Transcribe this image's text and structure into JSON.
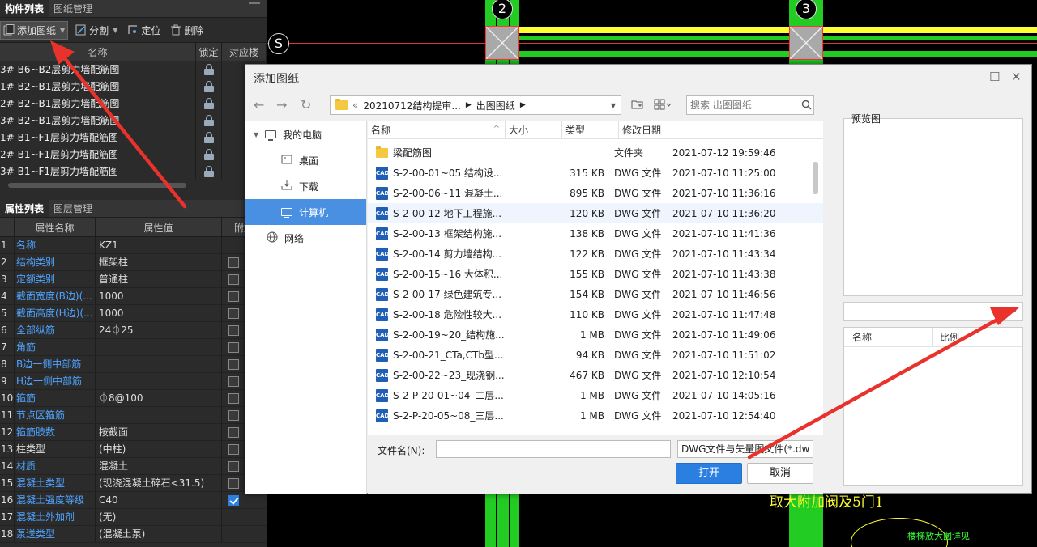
{
  "colors": {
    "accent": "#2b7fe0",
    "arrow": "#e8322b",
    "cad_yellow": "#ffff33",
    "cad_green": "#22cc22",
    "link_blue": "#4ea3ff"
  },
  "cad": {
    "axis_2": "2",
    "axis_3": "3",
    "axis_s": "S",
    "text_bottom": "取大附加阀及5门1",
    "text_right": "楼梯放大图详见"
  },
  "component_panel": {
    "tabs": [
      "构件列表",
      "图纸管理"
    ],
    "toolbar": {
      "add": "添加图纸",
      "split": "分割",
      "locate": "定位",
      "delete": "删除"
    },
    "columns": [
      "名称",
      "锁定",
      "对应楼"
    ],
    "rows": [
      "3#-B6~B2层剪力墙配筋图",
      "1#-B2~B1层剪力墙配筋图",
      "2#-B2~B1层剪力墙配筋图",
      "3#-B2~B1层剪力墙配筋图",
      "1#-B1~F1层剪力墙配筋图",
      "2#-B1~F1层剪力墙配筋图",
      "3#-B1~F1层剪力墙配筋图"
    ]
  },
  "property_panel": {
    "tabs": [
      "属性列表",
      "图层管理"
    ],
    "columns": [
      "属性名称",
      "属性值",
      "附加"
    ],
    "rows": [
      {
        "idx": "1",
        "name": "名称",
        "value": "KZ1",
        "checkbox": false,
        "checked": false,
        "blue": true
      },
      {
        "idx": "2",
        "name": "结构类别",
        "value": "框架柱",
        "checkbox": true,
        "checked": false,
        "blue": true
      },
      {
        "idx": "3",
        "name": "定额类别",
        "value": "普通柱",
        "checkbox": true,
        "checked": false,
        "blue": true
      },
      {
        "idx": "4",
        "name": "截面宽度(B边)(...",
        "value": "1000",
        "checkbox": true,
        "checked": false,
        "blue": true
      },
      {
        "idx": "5",
        "name": "截面高度(H边)(...",
        "value": "1000",
        "checkbox": true,
        "checked": false,
        "blue": true
      },
      {
        "idx": "6",
        "name": "全部纵筋",
        "value": "24⏀25",
        "checkbox": true,
        "checked": false,
        "blue": true
      },
      {
        "idx": "7",
        "name": "角筋",
        "value": "",
        "checkbox": true,
        "checked": false,
        "blue": true
      },
      {
        "idx": "8",
        "name": "B边一侧中部筋",
        "value": "",
        "checkbox": true,
        "checked": false,
        "blue": true
      },
      {
        "idx": "9",
        "name": "H边一侧中部筋",
        "value": "",
        "checkbox": true,
        "checked": false,
        "blue": true
      },
      {
        "idx": "10",
        "name": "箍筋",
        "value": "⏀8@100",
        "checkbox": true,
        "checked": false,
        "blue": true
      },
      {
        "idx": "11",
        "name": "节点区箍筋",
        "value": "",
        "checkbox": true,
        "checked": false,
        "blue": true
      },
      {
        "idx": "12",
        "name": "箍筋肢数",
        "value": "按截面",
        "checkbox": true,
        "checked": false,
        "blue": true
      },
      {
        "idx": "13",
        "name": "柱类型",
        "value": "(中柱)",
        "checkbox": true,
        "checked": false,
        "blue": false
      },
      {
        "idx": "14",
        "name": "材质",
        "value": "混凝土",
        "checkbox": true,
        "checked": false,
        "blue": true
      },
      {
        "idx": "15",
        "name": "混凝土类型",
        "value": "(现浇混凝土碎石<31.5)",
        "checkbox": true,
        "checked": false,
        "blue": true
      },
      {
        "idx": "16",
        "name": "混凝土强度等级",
        "value": "C40",
        "checkbox": true,
        "checked": true,
        "blue": true
      },
      {
        "idx": "17",
        "name": "混凝土外加剂",
        "value": "(无)",
        "checkbox": false,
        "checked": false,
        "blue": true
      },
      {
        "idx": "18",
        "name": "泵送类型",
        "value": "(混凝土泵)",
        "checkbox": false,
        "checked": false,
        "blue": true
      }
    ]
  },
  "dialog": {
    "title": "添加图纸",
    "path": [
      "20210712结构提审...",
      "出图图纸"
    ],
    "search_placeholder": "搜索 出图图纸",
    "sidebar": {
      "my_pc": "我的电脑",
      "desktop": "桌面",
      "downloads": "下载",
      "computer": "计算机",
      "network": "网络"
    },
    "columns": {
      "name": "名称",
      "size": "大小",
      "type": "类型",
      "date": "修改日期"
    },
    "files": [
      {
        "name": "梁配筋图",
        "size": "",
        "type": "文件夹",
        "date": "2021-07-12 19:59:46",
        "folder": true
      },
      {
        "name": "S-2-00-01~05 结构设...",
        "size": "315 KB",
        "type": "DWG 文件",
        "date": "2021-07-10 11:25:00",
        "folder": false
      },
      {
        "name": "S-2-00-06~11 混凝土...",
        "size": "895 KB",
        "type": "DWG 文件",
        "date": "2021-07-10 11:36:16",
        "folder": false
      },
      {
        "name": "S-2-00-12 地下工程施...",
        "size": "120 KB",
        "type": "DWG 文件",
        "date": "2021-07-10 11:36:20",
        "folder": false
      },
      {
        "name": "S-2-00-13 框架结构施...",
        "size": "138 KB",
        "type": "DWG 文件",
        "date": "2021-07-10 11:41:36",
        "folder": false
      },
      {
        "name": "S-2-00-14 剪力墙结构...",
        "size": "122 KB",
        "type": "DWG 文件",
        "date": "2021-07-10 11:43:34",
        "folder": false
      },
      {
        "name": "S-2-00-15~16 大体积...",
        "size": "155 KB",
        "type": "DWG 文件",
        "date": "2021-07-10 11:43:38",
        "folder": false
      },
      {
        "name": "S-2-00-17 绿色建筑专...",
        "size": "154 KB",
        "type": "DWG 文件",
        "date": "2021-07-10 11:46:56",
        "folder": false
      },
      {
        "name": "S-2-00-18 危险性较大...",
        "size": "110 KB",
        "type": "DWG 文件",
        "date": "2021-07-10 11:47:48",
        "folder": false
      },
      {
        "name": "S-2-00-19~20_结构施...",
        "size": "1 MB",
        "type": "DWG 文件",
        "date": "2021-07-10 11:49:06",
        "folder": false
      },
      {
        "name": "S-2-00-21_CTa,CTb型...",
        "size": "94 KB",
        "type": "DWG 文件",
        "date": "2021-07-10 11:51:02",
        "folder": false
      },
      {
        "name": "S-2-00-22~23_现浇钢...",
        "size": "467 KB",
        "type": "DWG 文件",
        "date": "2021-07-10 12:10:54",
        "folder": false
      },
      {
        "name": "S-2-P-20-01~04_二层...",
        "size": "1 MB",
        "type": "DWG 文件",
        "date": "2021-07-10 14:05:16",
        "folder": false
      },
      {
        "name": "S-2-P-20-05~08_三层...",
        "size": "1 MB",
        "type": "DWG 文件",
        "date": "2021-07-10 12:54:40",
        "folder": false
      }
    ],
    "filename_label": "文件名(N):",
    "filename_value": "",
    "filetype": "DWG文件与矢量图文件(*.dw",
    "open": "打开",
    "cancel": "取消",
    "preview_label": "预览图",
    "layer_columns": {
      "name": "名称",
      "ratio": "比例"
    }
  }
}
